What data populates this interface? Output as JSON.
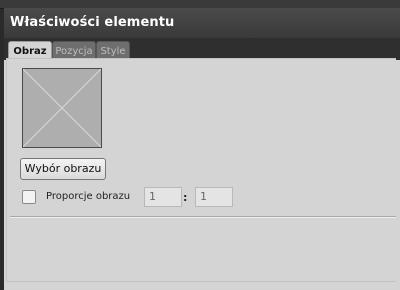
{
  "panel": {
    "title": "Właściwości elementu"
  },
  "tabs": [
    {
      "label": "Obraz",
      "active": true
    },
    {
      "label": "Pozycja",
      "active": false
    },
    {
      "label": "Style",
      "active": false
    }
  ],
  "image": {
    "placeholder_icon": "broken-image-cross-icon",
    "select_button_label": "Wybór obrazu"
  },
  "aspect_ratio": {
    "label": "Proporcje obrazu",
    "checked": false,
    "width_value": "1",
    "height_value": "1",
    "separator": ":"
  },
  "colors": {
    "title_bar": "#3a3a3a",
    "panel_bg": "#d4d4d4",
    "active_tab_bg": "#d4d4d4",
    "inactive_tab_bg": "#6e6e6e"
  }
}
